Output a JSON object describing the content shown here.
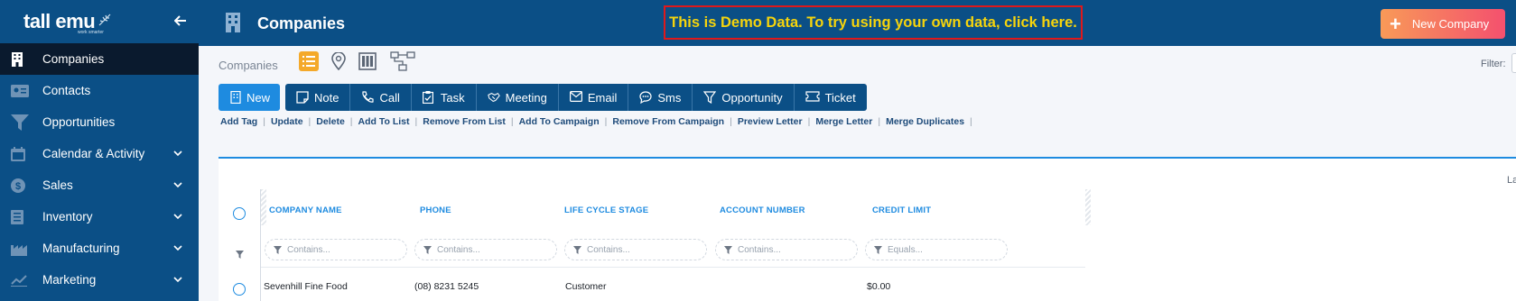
{
  "brand": {
    "name": "tall emu",
    "tagline": "work smarter"
  },
  "sidebar": {
    "items": [
      {
        "label": "Companies",
        "icon": "building-icon",
        "active": true,
        "expandable": false
      },
      {
        "label": "Contacts",
        "icon": "contact-card-icon",
        "active": false,
        "expandable": false
      },
      {
        "label": "Opportunities",
        "icon": "funnel-icon",
        "active": false,
        "expandable": false
      },
      {
        "label": "Calendar & Activity",
        "icon": "calendar-icon",
        "active": false,
        "expandable": true
      },
      {
        "label": "Sales",
        "icon": "dollar-icon",
        "active": false,
        "expandable": true
      },
      {
        "label": "Inventory",
        "icon": "inventory-icon",
        "active": false,
        "expandable": true
      },
      {
        "label": "Manufacturing",
        "icon": "factory-icon",
        "active": false,
        "expandable": true
      },
      {
        "label": "Marketing",
        "icon": "chart-trend-icon",
        "active": false,
        "expandable": true
      }
    ]
  },
  "header": {
    "title": "Companies",
    "demo_banner": "This is Demo Data. To try using your own data, click here.",
    "new_button": "New Company"
  },
  "toolbar": {
    "breadcrumb": "Companies",
    "filter_label": "Filter:",
    "views": [
      "list-view-icon",
      "map-pin-icon",
      "kanban-icon",
      "hierarchy-icon"
    ],
    "actions": {
      "new": "New",
      "items": [
        "Note",
        "Call",
        "Task",
        "Meeting",
        "Email",
        "Sms",
        "Opportunity",
        "Ticket"
      ]
    },
    "links": [
      "Add Tag",
      "Update",
      "Delete",
      "Add To List",
      "Remove From List",
      "Add To Campaign",
      "Remove From Campaign",
      "Preview Letter",
      "Merge Letter",
      "Merge Duplicates"
    ]
  },
  "grid": {
    "layout_label": "Layout",
    "columns": [
      {
        "header": "COMPANY NAME",
        "filter_placeholder": "Contains..."
      },
      {
        "header": "PHONE",
        "filter_placeholder": "Contains..."
      },
      {
        "header": "LIFE CYCLE STAGE",
        "filter_placeholder": "Contains..."
      },
      {
        "header": "ACCOUNT NUMBER",
        "filter_placeholder": "Contains..."
      },
      {
        "header": "CREDIT LIMIT",
        "filter_placeholder": "Equals..."
      }
    ],
    "rows": [
      {
        "company": "Sevenhill Fine Food",
        "phone": "(08) 8231 5245",
        "stage": "Customer",
        "account": "",
        "credit": "$0.00"
      }
    ]
  },
  "colors": {
    "sidebar": "#0b4f86",
    "accent": "#1e8be0",
    "banner_text": "#f6d40c",
    "banner_border": "#e0181b"
  }
}
